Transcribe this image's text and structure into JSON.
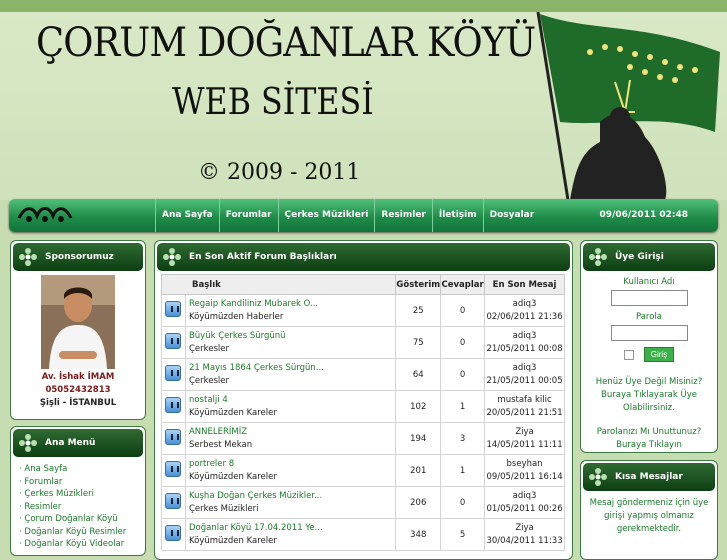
{
  "header": {
    "title_line1": "ÇORUM DOĞANLAR KÖYÜ",
    "title_line2": "WEB SİTESİ",
    "copyright": "© 2009 - 2011"
  },
  "nav": {
    "links": [
      "Ana Sayfa",
      "Forumlar",
      "Çerkes Müzikleri",
      "Resimler",
      "İletişim",
      "Dosyalar"
    ],
    "datetime": "09/06/2011 02:48"
  },
  "sponsor": {
    "title": "Sponsorumuz",
    "name": "Av. İshak İMAM",
    "phone": "05052432813",
    "location": "Şişli - İSTANBUL"
  },
  "menu": {
    "title": "Ana Menü",
    "items": [
      "Ana Sayfa",
      "Forumlar",
      "Çerkes Müzikleri",
      "Resimler",
      "Çorum Doğanlar Köyü",
      "Doğanlar Köyü Resimler",
      "Doğanlar Köyü Videolar"
    ]
  },
  "forum": {
    "title": "En Son Aktif Forum Başlıkları",
    "columns": [
      "Başlık",
      "Gösterim",
      "Cevaplar",
      "En Son Mesaj"
    ],
    "rows": [
      {
        "title": "Regaip Kandiliniz Mubarek O...",
        "category": "Köyümüzden Haberler",
        "views": "25",
        "replies": "0",
        "user": "adiq3",
        "date": "02/06/2011 21:36"
      },
      {
        "title": "Büyük Çerkes Sürgünü",
        "category": "Çerkesler",
        "views": "75",
        "replies": "0",
        "user": "adiq3",
        "date": "21/05/2011 00:08"
      },
      {
        "title": "21 Mayıs 1864 Çerkes Sürgün...",
        "category": "Çerkesler",
        "views": "64",
        "replies": "0",
        "user": "adiq3",
        "date": "21/05/2011 00:05"
      },
      {
        "title": "nostalji 4",
        "category": "Köyümüzden Kareler",
        "views": "102",
        "replies": "1",
        "user": "mustafa kilic",
        "date": "20/05/2011 21:51"
      },
      {
        "title": "ANNELERİMİZ",
        "category": "Serbest Mekan",
        "views": "194",
        "replies": "3",
        "user": "Ziya",
        "date": "14/05/2011 11:11"
      },
      {
        "title": "portreler 8",
        "category": "Köyümüzden Kareler",
        "views": "201",
        "replies": "1",
        "user": "bseyhan",
        "date": "09/05/2011 16:14"
      },
      {
        "title": "Kuşha Doğan Çerkes Müzikler...",
        "category": "Çerkes Müzikleri",
        "views": "206",
        "replies": "0",
        "user": "adiq3",
        "date": "01/05/2011 00:26"
      },
      {
        "title": "Doğanlar Köyü 17.04.2011 Ye...",
        "category": "Köyümüzden Kareler",
        "views": "348",
        "replies": "5",
        "user": "Ziya",
        "date": "30/04/2011 11:33"
      }
    ]
  },
  "login": {
    "title": "Üye Girişi",
    "username_label": "Kullanıcı Adı",
    "password_label": "Parola",
    "submit": "Giriş",
    "register_text": "Henüz Üye Değil Misiniz? Buraya Tıklayarak Üye Olabilirsiniz.",
    "forgot_text": "Parolanızı Mı Unuttunuz? Buraya Tıklayın"
  },
  "shoutbox": {
    "title": "Kısa Mesajlar",
    "notice": "Mesaj göndermeniz için üye girişi yapmış olmanız gerekmektedir."
  },
  "colors": {
    "nav_green": "#1f8d49",
    "panel_head": "#0d3e12",
    "link_green": "#1a7a2a",
    "background": "#c7dcb1"
  }
}
